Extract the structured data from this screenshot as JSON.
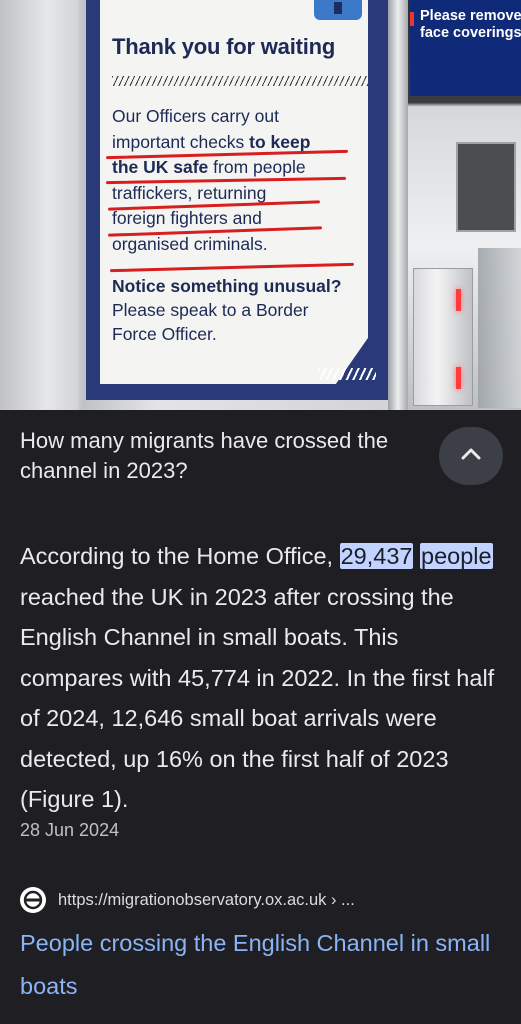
{
  "photo": {
    "poster": {
      "title": "Thank you for waiting",
      "body_line1": "Our Officers carry out",
      "body_line2": "important checks",
      "body_line2b": "to keep",
      "body_line3a": "the UK safe",
      "body_line3b": "from people",
      "body_line4": "traffickers, returning",
      "body_line5": "foreign fighters and",
      "body_line6": "organised criminals.",
      "notice_bold": "Notice something unusual?",
      "notice_line2": "Please speak to a Border",
      "notice_line3": "Force Officer."
    },
    "sign": {
      "line1": "Please remove",
      "line2": "face coverings"
    },
    "annotation_color": "#d81e1e"
  },
  "result": {
    "question": "How many migrants have crossed the channel in 2023?",
    "collapse_icon": "chevron-up-icon",
    "answer_before": "According to the Home Office, ",
    "answer_highlight_1": "29,437",
    "answer_highlight_2": "people",
    "answer_after": " reached the UK in 2023 after crossing the English Channel in small boats. This compares with 45,774 in 2022. In the first half of 2024, 12,646 small boat arrivals were detected, up 16% on the first half of 2023 (Figure 1).",
    "date": "28 Jun 2024",
    "source_icon": "site-favicon-icon",
    "source_url": "https://migrationobservatory.ox.ac.uk › ...",
    "link_title": "People crossing the English Channel in small boats",
    "highlight_color": "#c2d3ff",
    "link_color": "#8ab4f8"
  }
}
